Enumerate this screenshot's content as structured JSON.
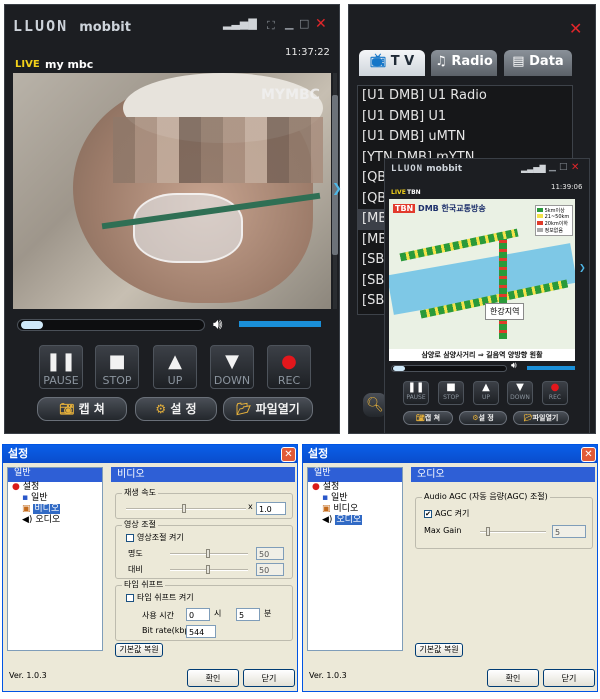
{
  "player": {
    "logo": "LLUON",
    "logo_sub": "mobbit",
    "clock": "11:37:22",
    "live": "LIVE",
    "channel": "my mbc",
    "watermark": "MYMBC",
    "buttons": {
      "pause": "PAUSE",
      "stop": "STOP",
      "up": "UP",
      "down": "DOWN",
      "rec": "REC"
    },
    "pills": {
      "capture": "캡 쳐",
      "settings": "설 정",
      "open_file": "파일열기"
    }
  },
  "right_panel": {
    "tabs": {
      "tv": "T V",
      "radio": "Radio",
      "data": "Data"
    },
    "channels": [
      "[U1 DMB] U1 Radio",
      "[U1 DMB] U1",
      "[U1 DMB] uMTN",
      "[YTN DMB] mYTN",
      "[QBS",
      "[QBS",
      "[MB",
      "[MB",
      "[SBS",
      "[SBS",
      "[SBS"
    ],
    "selected_index": 6
  },
  "mini_player": {
    "logo": "LLUON",
    "logo_sub": "mobbit",
    "clock": "11:39:06",
    "live": "LIVE",
    "channel": "TBN",
    "station": "TBN",
    "station_sub": "DMB 한국교통방송",
    "legend": [
      "5km이상",
      "21~50km",
      "20km이하",
      "정보없음"
    ],
    "center_label": "한강지역",
    "ticker": "삼양로 삼양사거리 ⇒ 길음역 양방향 원활",
    "buttons": {
      "pause": "PAUSE",
      "stop": "STOP",
      "up": "UP",
      "down": "DOWN",
      "rec": "REC"
    },
    "pills": {
      "capture": "캡 쳐",
      "settings": "설 정",
      "open_file": "파일열기"
    }
  },
  "dialog_video": {
    "title": "설정",
    "tree_root": "일반",
    "tree": [
      "설정",
      "일반",
      "비디오",
      "오디오"
    ],
    "selected": "비디오",
    "section": "비디오",
    "playback_group": "재생 속도",
    "playback_x": "x",
    "playback_value": "1.0",
    "video_group": "영상 조절",
    "video_enable": "영상조절 켜기",
    "brightness_label": "명도",
    "brightness_value": "50",
    "contrast_label": "대비",
    "contrast_value": "50",
    "timeshift_group": "타임 쉬프트",
    "timeshift_enable": "타임 쉬프트 켜기",
    "usage_time": "사용 시간",
    "hour_value": "0",
    "hour_unit": "시",
    "min_value": "5",
    "min_unit": "분",
    "bitrate_label": "Bit rate(kbps)",
    "bitrate_value": "544",
    "reset": "기본값 복원",
    "version": "Ver. 1.0.3",
    "ok": "확인",
    "close": "닫기"
  },
  "dialog_audio": {
    "title": "설정",
    "tree_root": "일반",
    "tree": [
      "설정",
      "일반",
      "비디오",
      "오디오"
    ],
    "selected": "오디오",
    "section": "오디오",
    "agc_group": "Audio AGC (자동 음량(AGC) 조절)",
    "agc_enable": "AGC 켜기",
    "agc_checked": "✔",
    "max_gain_label": "Max Gain",
    "max_gain_value": "5",
    "reset": "기본값 복원",
    "version": "Ver. 1.0.3",
    "ok": "확인",
    "close": "닫기"
  }
}
